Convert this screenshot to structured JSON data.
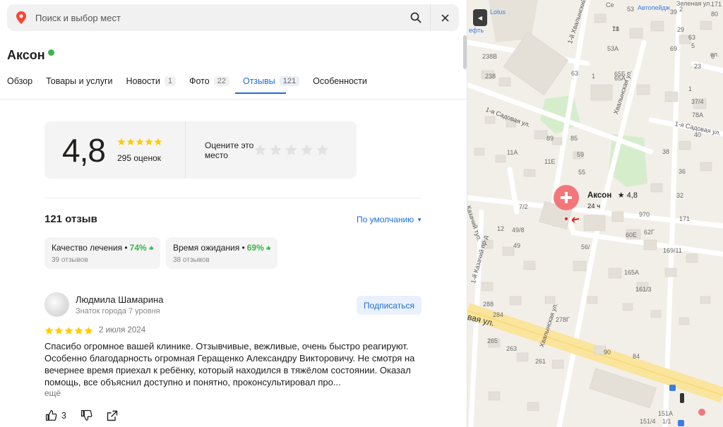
{
  "search": {
    "placeholder": "Поиск и выбор мест"
  },
  "place": {
    "title": "Аксон"
  },
  "tabs": [
    {
      "label": "Обзор",
      "count": ""
    },
    {
      "label": "Товары и услуги",
      "count": ""
    },
    {
      "label": "Новости",
      "count": "1"
    },
    {
      "label": "Фото",
      "count": "22"
    },
    {
      "label": "Отзывы",
      "count": "121"
    },
    {
      "label": "Особенности",
      "count": ""
    }
  ],
  "summary": {
    "rating": "4,8",
    "ratings_count": "295 оценок",
    "rate_prompt": "Оцените это место",
    "stars_filled": 5
  },
  "reviews": {
    "title": "121 отзыв",
    "sort_label": "По умолчанию",
    "aspects": [
      {
        "label": "Качество лечения •",
        "percent": "74%",
        "count": "39 отзывов"
      },
      {
        "label": "Время ожидания •",
        "percent": "69%",
        "count": "38 отзывов"
      }
    ],
    "items": [
      {
        "author": "Людмила Шамарина",
        "author_level": "Знаток города 7 уровня",
        "subscribe_label": "Подписаться",
        "stars": 5,
        "date": "2 июля 2024",
        "text": "Спасибо огромное вашей клинике. Отзывчивые, вежливые, очень быстро реагируют. Особенно благодарность огромная Геращенко Александру Викторовичу. Не смотря на вечернее время приехал к ребёнку, который находился в тяжёлом состоянии. Оказал помощь, все объяснил доступно и понятно, проконсультировал про...",
        "more_label": "ещё",
        "likes": "3"
      }
    ]
  },
  "map": {
    "pin": {
      "title": "Аксон",
      "rating": "4,8",
      "hours": "24 ч"
    },
    "poi_labels": [
      "Lotus",
      "Автопейдж",
      "ефть"
    ],
    "streets": [
      "1-й Хвалынский пр-д",
      "Хвалынская ул.",
      "1-я Садовая ул.",
      "1-я Садовая ул.",
      "1-й Казачий пр-д",
      "Казачий туп.",
      "Хвалынская ул.",
      "вая ул."
    ],
    "house_numbers": [
      "71",
      "53",
      "238В",
      "238",
      "53А",
      "65Б",
      "65А",
      "1",
      "63",
      "Зеленая ул.",
      "69",
      "89",
      "85",
      "11А",
      "59",
      "11Е",
      "55",
      "7/2",
      "37/4",
      "78А",
      "40",
      "38",
      "36",
      "32",
      "970",
      "62Г",
      "60Е",
      "171",
      "56/",
      "169/11",
      "12",
      "49/8",
      "49",
      "165А",
      "161/3",
      "288",
      "284",
      "278Г",
      "263",
      "265",
      "261",
      "90",
      "84",
      "151А",
      "151/4",
      "1/1",
      "171",
      "Се",
      "ол.",
      "6",
      "5",
      "1",
      "2",
      "80",
      "63",
      "29",
      "23",
      "39",
      "18"
    ],
    "colors": {
      "pin": "#f2777b",
      "road_major": "#fbe49b",
      "green": "#d5edcb"
    }
  }
}
